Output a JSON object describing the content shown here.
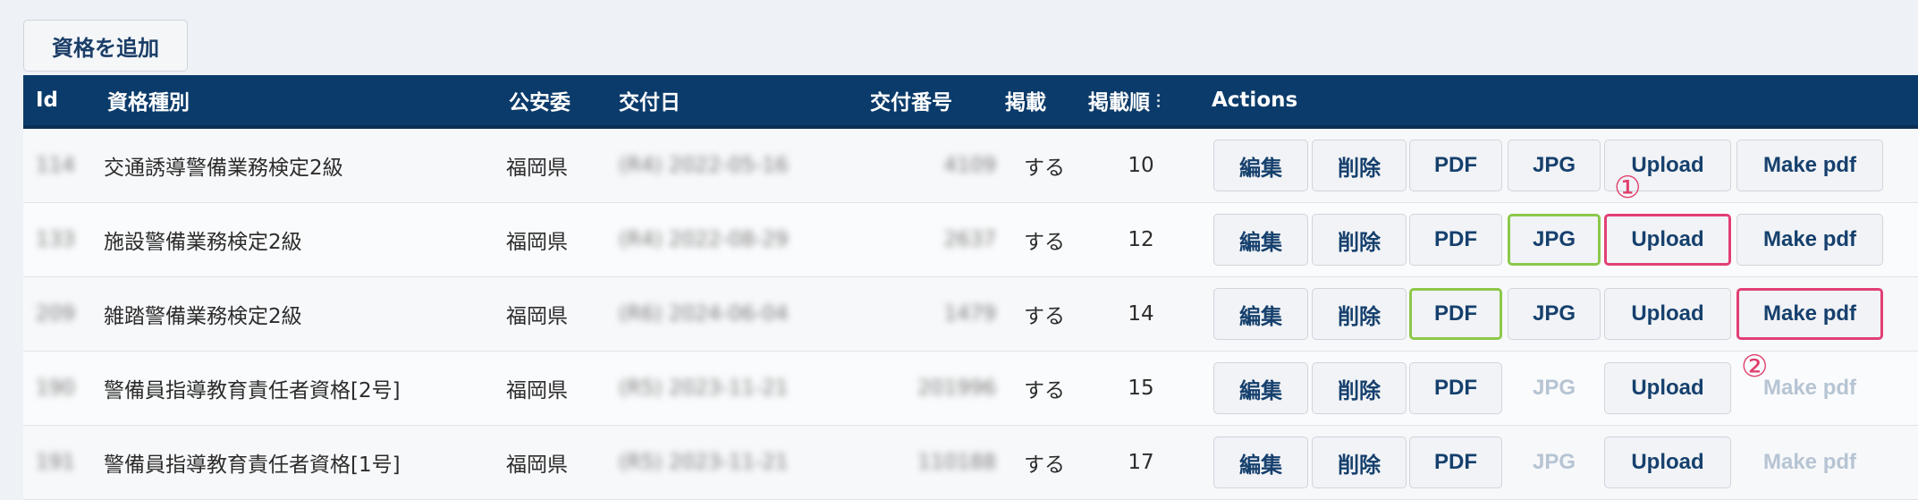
{
  "toolbar": {
    "add_label": "資格を追加"
  },
  "table": {
    "headers": {
      "id": "Id",
      "type": "資格種別",
      "commission": "公安委",
      "issue_date": "交付日",
      "issue_number": "交付番号",
      "publish": "掲載",
      "order": "掲載順",
      "actions": "Actions"
    },
    "rows": [
      {
        "id": "114",
        "type": "交通誘導警備業務検定2級",
        "commission": "福岡県",
        "issue_date": "(R4) 2022-05-16",
        "issue_number": "4109",
        "publish": "する",
        "order": "10"
      },
      {
        "id": "133",
        "type": "施設警備業務検定2級",
        "commission": "福岡県",
        "issue_date": "(R4) 2022-08-29",
        "issue_number": "2637",
        "publish": "する",
        "order": "12"
      },
      {
        "id": "209",
        "type": "雑踏警備業務検定2級",
        "commission": "福岡県",
        "issue_date": "(R6) 2024-06-04",
        "issue_number": "1479",
        "publish": "する",
        "order": "14"
      },
      {
        "id": "190",
        "type": "警備員指導教育責任者資格[2号]",
        "commission": "福岡県",
        "issue_date": "(R5) 2023-11-21",
        "issue_number": "201996",
        "publish": "する",
        "order": "15"
      },
      {
        "id": "191",
        "type": "警備員指導教育責任者資格[1号]",
        "commission": "福岡県",
        "issue_date": "(R5) 2023-11-21",
        "issue_number": "110188",
        "publish": "する",
        "order": "17"
      }
    ]
  },
  "actions": {
    "edit": "編集",
    "delete": "削除",
    "pdf": "PDF",
    "jpg": "JPG",
    "upload": "Upload",
    "make_pdf": "Make pdf"
  },
  "annotations": {
    "marker1": "①",
    "marker2": "②"
  },
  "colors": {
    "header_bg": "#0b3b6a",
    "highlight_green": "#8cc84b",
    "highlight_pink": "#e23f75",
    "button_text": "#16406d",
    "disabled_text": "#b6c4d3"
  }
}
